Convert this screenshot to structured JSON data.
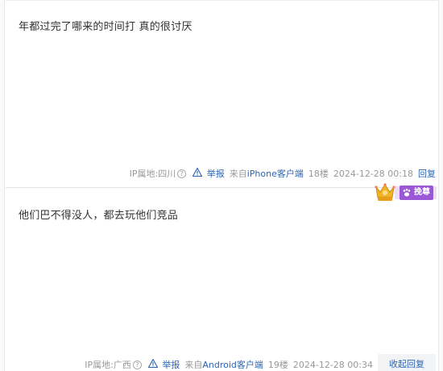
{
  "colors": {
    "link": "#2d64b3",
    "meta": "#999999",
    "text": "#333333",
    "badge_purple": "#9a58d6",
    "badge_gold": "#f0b429"
  },
  "posts": [
    {
      "content": "年都过完了哪来的时间打 真的很讨厌",
      "ip_label": "IP属地:四川",
      "report_label": "举报",
      "client_prefix": "来自",
      "client_name": "iPhone客户端",
      "floor": "18楼",
      "time": "2024-12-28 00:18",
      "reply_label": "回复"
    },
    {
      "content": "他们巴不得没人，都去玩他们竞品",
      "ip_label": "IP属地:广西",
      "report_label": "举报",
      "client_prefix": "来自",
      "client_name": "Android客户端",
      "floor": "19楼",
      "time": "2024-12-28 00:34",
      "reply_label": "收起回复"
    }
  ],
  "badge": {
    "icon": "crown-icon",
    "label": "挽尊"
  }
}
